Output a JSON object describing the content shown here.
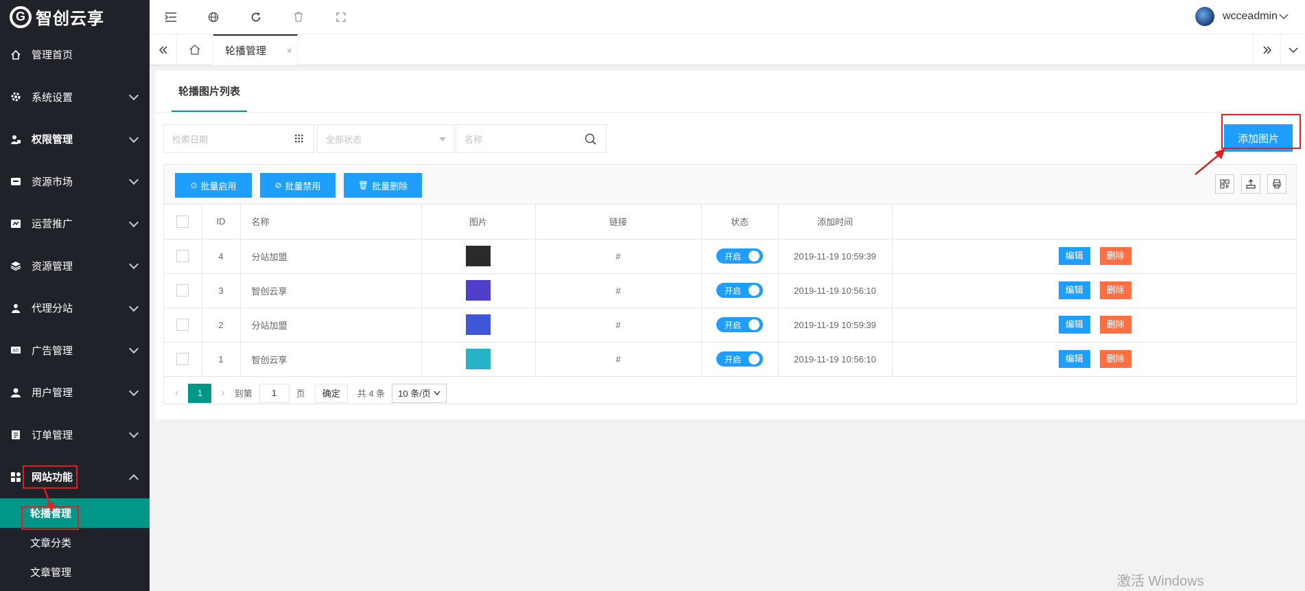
{
  "app": {
    "logo_mark": "G",
    "logo_text": "智创云享"
  },
  "sidebar": {
    "items": [
      {
        "label": "管理首页",
        "icon": "home-icon"
      },
      {
        "label": "系统设置",
        "icon": "gear-icon"
      },
      {
        "label": "权限管理",
        "icon": "user-lock-icon"
      },
      {
        "label": "资源市场",
        "icon": "store-icon"
      },
      {
        "label": "运营推广",
        "icon": "promo-icon"
      },
      {
        "label": "资源管理",
        "icon": "layers-icon"
      },
      {
        "label": "代理分站",
        "icon": "agent-icon"
      },
      {
        "label": "广告管理",
        "icon": "ad-icon"
      },
      {
        "label": "用户管理",
        "icon": "user-icon"
      },
      {
        "label": "订单管理",
        "icon": "clipboard-icon"
      },
      {
        "label": "网站功能",
        "icon": "grid-icon"
      }
    ],
    "sub_items": [
      {
        "label": "轮播管理"
      },
      {
        "label": "文章分类"
      },
      {
        "label": "文章管理"
      }
    ]
  },
  "topbar": {
    "username": "wcceadmin"
  },
  "tabs": {
    "active": "轮播管理",
    "close": "×"
  },
  "card": {
    "title": "轮播图片列表"
  },
  "search": {
    "date_placeholder": "检索日期",
    "status_placeholder": "全部状态",
    "name_placeholder": "名称"
  },
  "add_button": "添加图片",
  "toolbar": {
    "enable": "批量启用",
    "disable": "批量禁用",
    "delete": "批量删除"
  },
  "table": {
    "headers": [
      "ID",
      "名称",
      "图片",
      "链接",
      "状态",
      "添加时间"
    ],
    "rows": [
      {
        "id": "4",
        "name": "分站加盟",
        "link": "#",
        "status": "开启",
        "time": "2019-11-19 10:59:39",
        "thumb": "#2a2a2a"
      },
      {
        "id": "3",
        "name": "智创云享",
        "link": "#",
        "status": "开启",
        "time": "2019-11-19 10:56:10",
        "thumb": "#4f3fc9"
      },
      {
        "id": "2",
        "name": "分站加盟",
        "link": "#",
        "status": "开启",
        "time": "2019-11-19 10:59:39",
        "thumb": "#3f58d8"
      },
      {
        "id": "1",
        "name": "智创云享",
        "link": "#",
        "status": "开启",
        "time": "2019-11-19 10:56:10",
        "thumb": "#26b3c8"
      }
    ],
    "edit_label": "编辑",
    "delete_label": "删除"
  },
  "pager": {
    "current": "1",
    "goto": "到第",
    "page_input": "1",
    "page_unit": "页",
    "confirm": "确定",
    "total": "共 4 条",
    "per_page": "10 条/页"
  },
  "watermark": "激活 Windows",
  "colors": {
    "sidebar": "#20222a",
    "accent": "#009688",
    "primary": "#1e9fff",
    "danger": "#ff5722",
    "annotation": "#e02020"
  }
}
